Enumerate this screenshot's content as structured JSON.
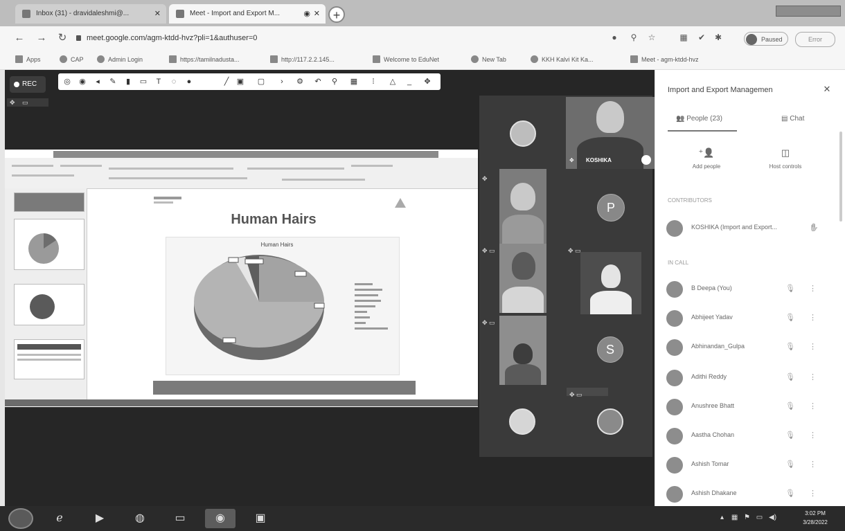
{
  "browser": {
    "tabs": [
      {
        "label": "Inbox (31) - dravidaleshmi@..."
      },
      {
        "label": "Meet - Import and Export M..."
      }
    ],
    "url": "meet.google.com/agm-ktdd-hvz?pli=1&authuser=0",
    "paused_label": "Paused",
    "more_label": "Error",
    "bookmarks": [
      "Apps",
      "CAP",
      "Admin Login",
      "https://tamilnadusta...",
      "http://117.2.2.145...",
      "Welcome to EduNet",
      "New Tab",
      "KKH Kalvi Kit Ka...",
      "Meet - agm-ktdd-hvz"
    ]
  },
  "meeting": {
    "rec_label": "REC",
    "slide": {
      "title": "Human Hairs",
      "chart_title": "Human Hairs"
    },
    "tiles": {
      "presenter_name": "KOSHIKA",
      "avatar_p": "P",
      "avatar_s": "S"
    }
  },
  "chart_data": {
    "type": "pie",
    "title": "Human Hairs",
    "values": [],
    "categories": []
  },
  "panel": {
    "title": "Import and Export Managemen",
    "tab_people": "People (23)",
    "tab_chat": "Chat",
    "add_people": "Add people",
    "host_controls": "Host controls",
    "section_contributors": "CONTRIBUTORS",
    "presenter_row": "KOSHIKA (Import and Export...",
    "section_in_call": "IN CALL",
    "participants": [
      "B Deepa (You)",
      "Abhijeet Yadav",
      "Abhinandan_Gulpa",
      "Adithi Reddy",
      "Anushree Bhatt",
      "Aastha Chohan",
      "Ashish Tomar",
      "Ashish Dhakane"
    ]
  },
  "taskbar": {
    "time": "3:02 PM",
    "date": "3/28/2022"
  }
}
